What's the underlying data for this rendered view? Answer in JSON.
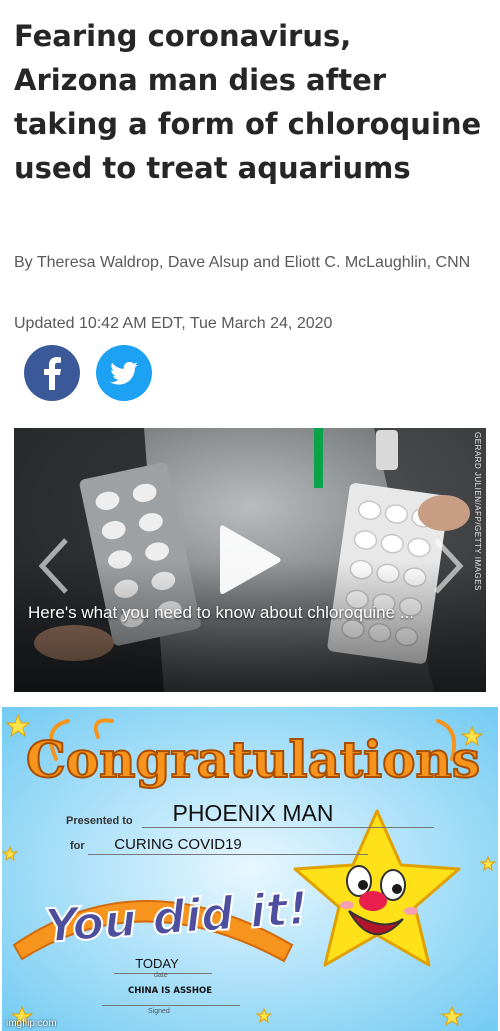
{
  "article": {
    "headline": "Fearing coronavirus, Arizona man dies after taking a form of chloroquine used to treat aquariums",
    "byline": "By Theresa Waldrop, Dave Alsup and Eliott C. McLaughlin, CNN",
    "updated": "Updated 10:42 AM EDT, Tue March 24, 2020",
    "share": {
      "facebook": "facebook-icon",
      "twitter": "twitter-icon"
    }
  },
  "video": {
    "caption": "Here's what you need to know about chloroquine ...",
    "photo_credit": "GERARD JULIEN/AFP/GETTY IMAGES"
  },
  "certificate": {
    "banner": "Congratulations",
    "presented_label": "Presented to",
    "recipient": "PHOENIX MAN",
    "for_label": "for",
    "reason": "CURING COVID19",
    "slogan": "You did it!",
    "date_value": "TODAY",
    "date_label": "date",
    "signature": "CHINA IS ASSHOE",
    "signed_label": "Signed"
  },
  "watermark": "imgflip.com",
  "colors": {
    "facebook": "#3b5998",
    "twitter": "#1da1f2",
    "headline": "#262626",
    "meta_text": "#595959",
    "cert_background": "#aee3ff",
    "cert_banner": "#f7941d",
    "cert_star": "#ffe11a"
  }
}
